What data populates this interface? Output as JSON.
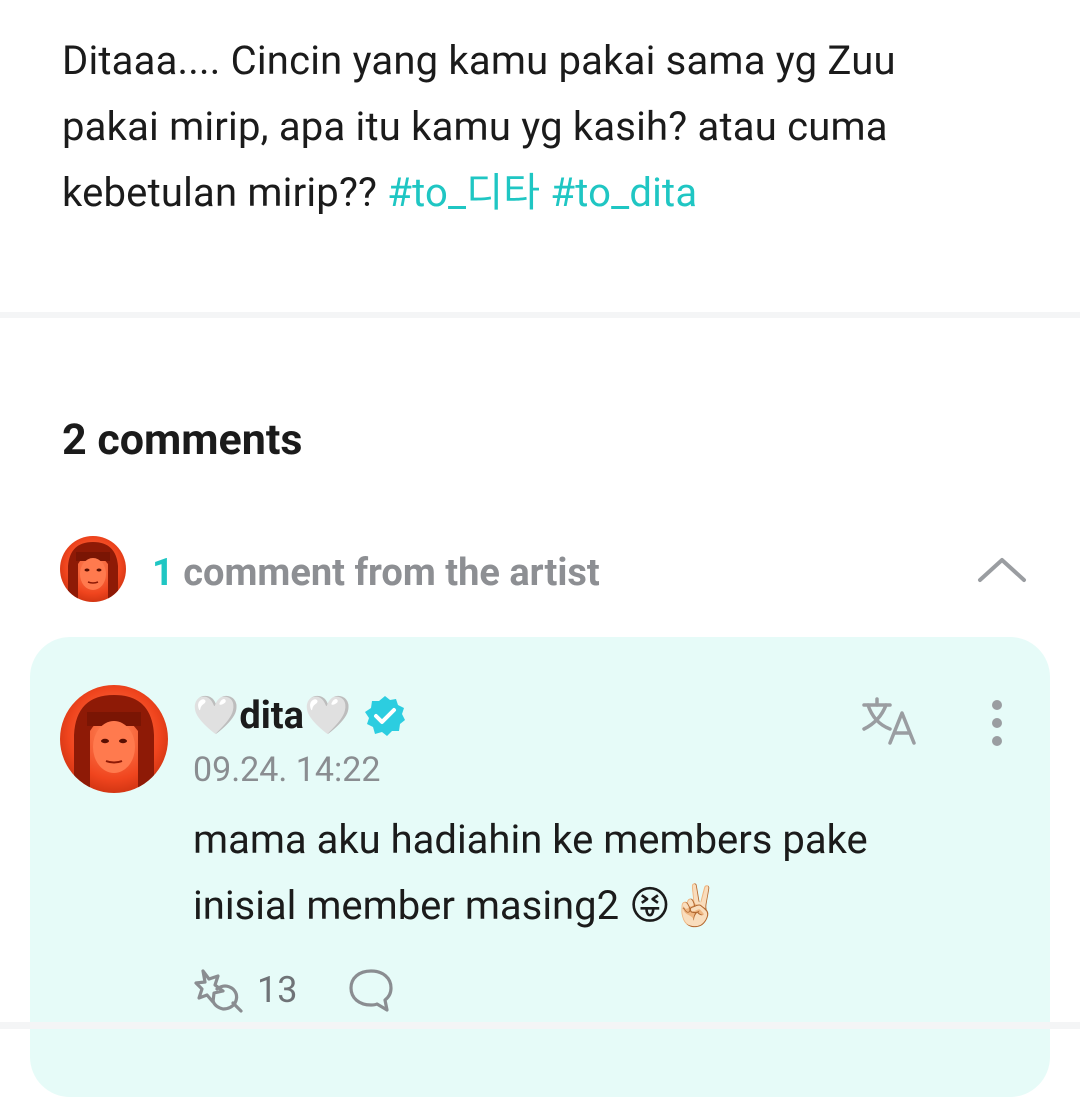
{
  "post": {
    "text_line1": "Ditaaa.... Cincin yang kamu pakai sama yg Zuu",
    "text_line2": "pakai mirip, apa itu kamu yg kasih? atau cuma",
    "text_line3": "kebetulan mirip?? ",
    "hashtag1": "#to_디타",
    "hashtag2": "#to_dita"
  },
  "comments": {
    "count_label": "2 comments",
    "artist_section": {
      "count": "1",
      "label": " comment from the artist",
      "expanded": true
    },
    "artist_comment": {
      "author": "🤍dita🤍",
      "verified": true,
      "timestamp": "09.24. 14:22",
      "text_line1": "mama aku hadiahin ke members pake",
      "text_line2": "inisial member masing2 😝✌🏻",
      "like_count": "13"
    }
  },
  "colors": {
    "accent": "#1fc6c3",
    "card_background": "#e6fbf8",
    "muted_text": "#8d8f93",
    "verified_badge": "#2ccde0"
  },
  "icons": {
    "translate": "translate-icon",
    "more": "more-vertical-icon",
    "like": "like-icon",
    "reply": "reply-icon",
    "collapse": "chevron-up-icon",
    "verified": "verified-badge-icon"
  }
}
